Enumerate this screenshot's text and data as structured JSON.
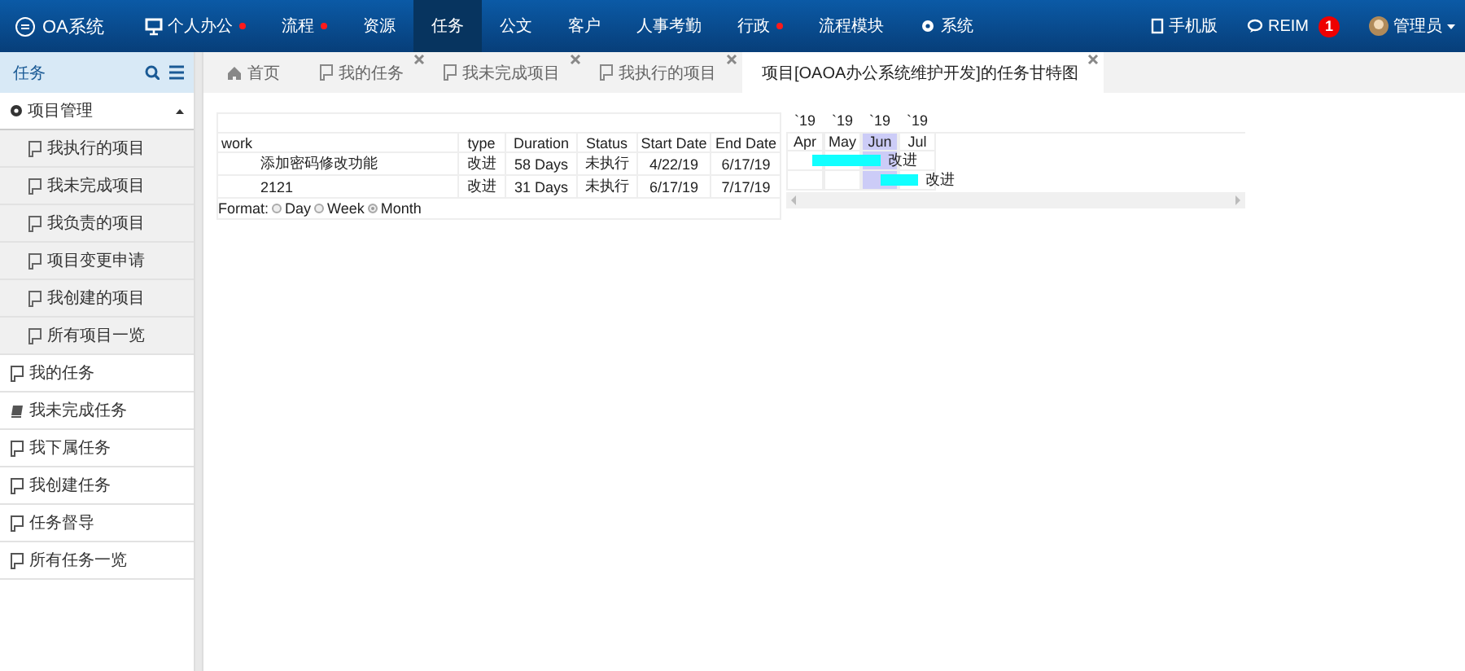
{
  "topbar": {
    "logo": "OA系统",
    "menu": [
      {
        "label": "个人办公",
        "kind": "monitor",
        "dot": true,
        "selected": false
      },
      {
        "label": "流程",
        "kind": "plain",
        "dot": true,
        "selected": false
      },
      {
        "label": "资源",
        "kind": "plain",
        "dot": false,
        "selected": false
      },
      {
        "label": "任务",
        "kind": "plain",
        "dot": false,
        "selected": true
      },
      {
        "label": "公文",
        "kind": "plain",
        "dot": false,
        "selected": false
      },
      {
        "label": "客户",
        "kind": "plain",
        "dot": false,
        "selected": false
      },
      {
        "label": "人事考勤",
        "kind": "plain",
        "dot": false,
        "selected": false
      },
      {
        "label": "行政",
        "kind": "plain",
        "dot": true,
        "selected": false
      },
      {
        "label": "流程模块",
        "kind": "plain",
        "dot": false,
        "selected": false
      },
      {
        "label": "系统",
        "kind": "gear",
        "dot": false,
        "selected": false
      }
    ],
    "mobile": "手机版",
    "reim": "REIM",
    "reim_badge": "1",
    "user": "管理员"
  },
  "sidebar": {
    "title": "任务",
    "groups": [
      {
        "label": "项目管理",
        "expanded": true,
        "children": [
          {
            "label": "我执行的项目"
          },
          {
            "label": "我未完成项目"
          },
          {
            "label": "我负责的项目"
          },
          {
            "label": "项目变更申请"
          },
          {
            "label": "我创建的项目"
          },
          {
            "label": "所有项目一览"
          }
        ]
      }
    ],
    "items": [
      {
        "label": "我的任务",
        "kind": "flag"
      },
      {
        "label": "我未完成任务",
        "kind": "book"
      },
      {
        "label": "我下属任务",
        "kind": "flag"
      },
      {
        "label": "我创建任务",
        "kind": "flag"
      },
      {
        "label": "任务督导",
        "kind": "flag"
      },
      {
        "label": "所有任务一览",
        "kind": "flag"
      }
    ]
  },
  "tabs": [
    {
      "label": "首页",
      "kind": "home",
      "closable": false,
      "selected": false
    },
    {
      "label": "我的任务",
      "kind": "flag",
      "closable": true,
      "selected": false
    },
    {
      "label": "我未完成项目",
      "kind": "flag",
      "closable": true,
      "selected": false
    },
    {
      "label": "我执行的项目",
      "kind": "flag",
      "closable": true,
      "selected": false
    },
    {
      "label": "项目[OAOA办公系统维护开发]的任务甘特图",
      "kind": "plain",
      "closable": true,
      "selected": true
    }
  ],
  "gantt": {
    "columns": [
      "work",
      "type",
      "Duration",
      "Status",
      "Start Date",
      "End Date"
    ],
    "rows": [
      {
        "work": "添加密码修改功能",
        "type": "改进",
        "duration": "58 Days",
        "status": "未执行",
        "start": "4/22/19",
        "end": "6/17/19",
        "bar_label": "改进"
      },
      {
        "work": "2121",
        "type": "改进",
        "duration": "31 Days",
        "status": "未执行",
        "start": "6/17/19",
        "end": "7/17/19",
        "bar_label": "改进"
      }
    ],
    "months": [
      {
        "year": "`19",
        "label": "Apr",
        "highlighted": false
      },
      {
        "year": "`19",
        "label": "May",
        "highlighted": false
      },
      {
        "year": "`19",
        "label": "Jun",
        "highlighted": true
      },
      {
        "year": "`19",
        "label": "Jul",
        "highlighted": false
      }
    ],
    "format_label": "Format:",
    "formats": [
      {
        "label": "Day",
        "selected": false
      },
      {
        "label": "Week",
        "selected": false
      },
      {
        "label": "Month",
        "selected": true
      }
    ]
  }
}
